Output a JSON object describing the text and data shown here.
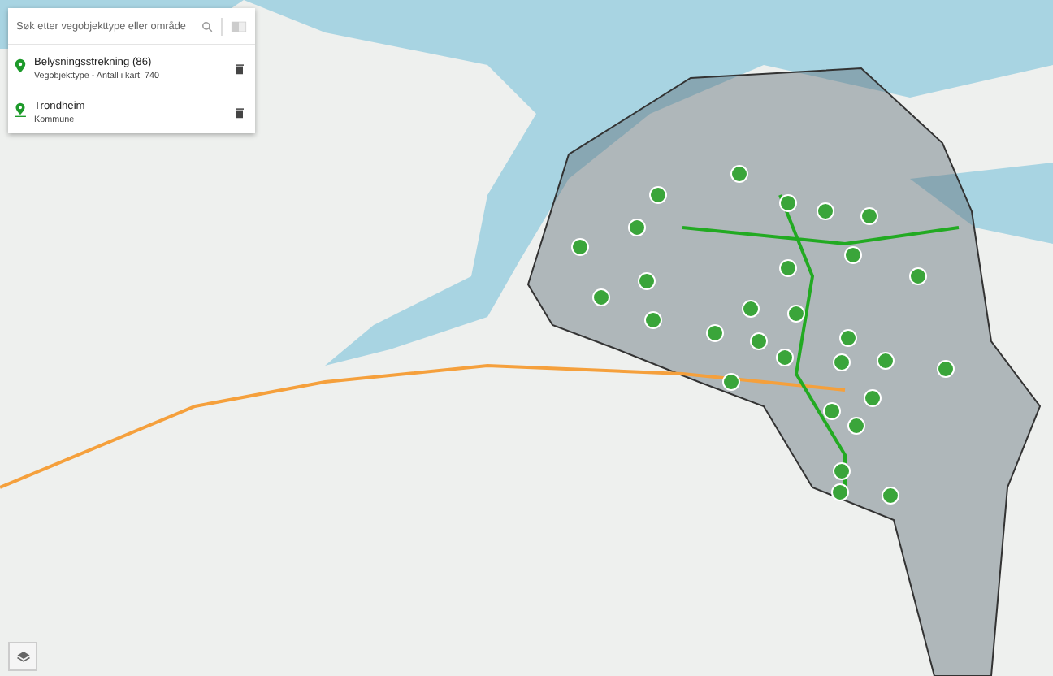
{
  "search": {
    "placeholder": "Søk etter vegobjekttype eller område"
  },
  "layers": [
    {
      "kind": "object-type",
      "title": "Belysningsstrekning (86)",
      "subtitle": "Vegobjekttype - Antall i kart: 740"
    },
    {
      "kind": "area",
      "title": "Trondheim",
      "subtitle": "Kommune"
    }
  ]
}
